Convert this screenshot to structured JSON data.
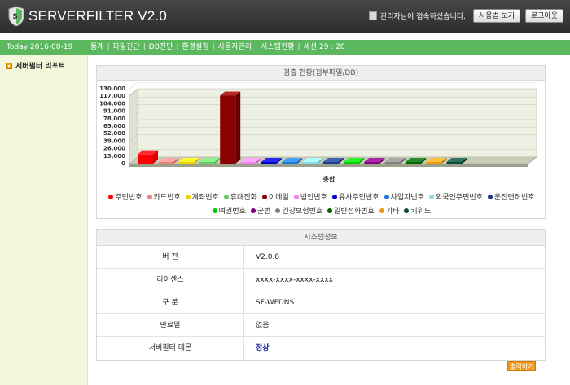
{
  "header": {
    "logo_text": "SERVERFILTER V2.0",
    "admin_message": "관리자님이 접속하셨습니다.",
    "manual_button": "사용법 보기",
    "logout_button": "로그아웃"
  },
  "navbar": {
    "today": "Today 2016-08-19",
    "menu": [
      "통계",
      "파일진단",
      "DB진단",
      "환경설정",
      "사용자관리",
      "시스템현황",
      "세션 29 : 20"
    ]
  },
  "sidebar": {
    "items": [
      {
        "label": "서버필터 리포트"
      }
    ]
  },
  "chart_panel": {
    "title": "검출 현황(첨부파일/DB)"
  },
  "chart_data": {
    "type": "bar",
    "xlabel": "총합",
    "y_ticks": [
      "130,000",
      "117,000",
      "104,000",
      "91,000",
      "78,000",
      "65,000",
      "52,000",
      "39,000",
      "26,000",
      "13,000",
      "0"
    ],
    "ylim": [
      0,
      130000
    ],
    "grid": true,
    "legend_position": "bottom",
    "series": [
      {
        "name": "주민번호",
        "value": 16000,
        "color": "#ff0000"
      },
      {
        "name": "카드번호",
        "value": 0,
        "color": "#f08080"
      },
      {
        "name": "계좌번호",
        "value": 0,
        "color": "#f0d000"
      },
      {
        "name": "휴대전화",
        "value": 0,
        "color": "#66cc66"
      },
      {
        "name": "이메일",
        "value": 118000,
        "color": "#8b0000"
      },
      {
        "name": "법인번호",
        "value": 0,
        "color": "#ee82ee"
      },
      {
        "name": "유사주민번호",
        "value": 0,
        "color": "#0000cc"
      },
      {
        "name": "사업자번호",
        "value": 0,
        "color": "#1e78d2"
      },
      {
        "name": "외국인주민번호",
        "value": 0,
        "color": "#87dde8"
      },
      {
        "name": "운전면허번호",
        "value": 0,
        "color": "#1a3a8a"
      },
      {
        "name": "여권번호",
        "value": 0,
        "color": "#00cc00"
      },
      {
        "name": "군번",
        "value": 0,
        "color": "#800080"
      },
      {
        "name": "건강보험번호",
        "value": 0,
        "color": "#808080"
      },
      {
        "name": "일반전화번호",
        "value": 0,
        "color": "#006400"
      },
      {
        "name": "기타",
        "value": 0,
        "color": "#e89a10"
      },
      {
        "name": "키워드",
        "value": 0,
        "color": "#0a4a3a"
      }
    ]
  },
  "system_info": {
    "title": "시스템정보",
    "rows": [
      {
        "key": "버 전",
        "value": "V2.0.8"
      },
      {
        "key": "라이센스",
        "value": "xxxx-xxxx-xxxx-xxxx"
      },
      {
        "key": "구 분",
        "value": "SF-WFDNS"
      },
      {
        "key": "만료일",
        "value": "없음"
      },
      {
        "key": "서버필터 데몬",
        "value": "정상"
      }
    ]
  },
  "print_button": "출력하기",
  "colors": {
    "header_bg": "#3a3a3a",
    "nav_green": "#5bb85f",
    "sidebar_bg": "#f5f7dc",
    "accent_orange": "#f39a1e",
    "status_ok": "#1f2aa0"
  }
}
